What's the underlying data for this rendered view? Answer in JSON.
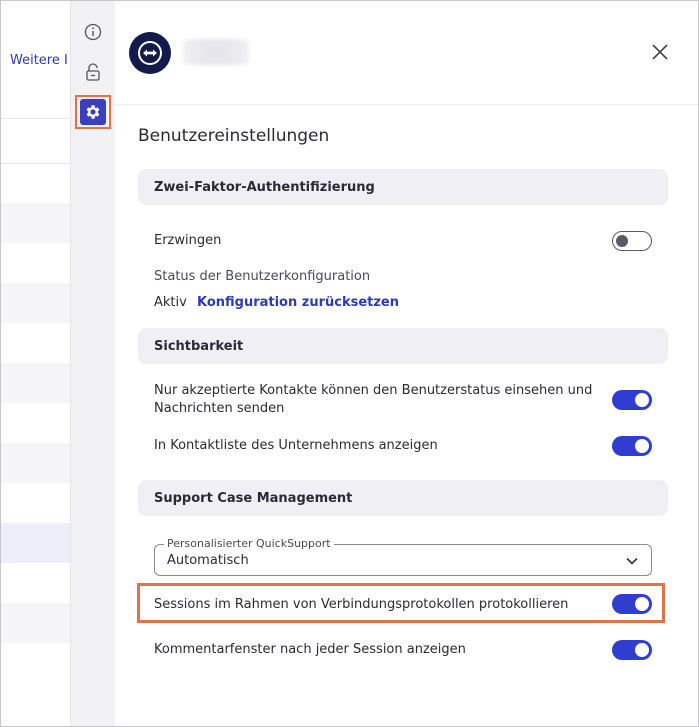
{
  "background": {
    "link_text": "Weitere I"
  },
  "rail": {
    "icons": [
      "info-icon",
      "lock-icon",
      "gear-icon"
    ]
  },
  "header": {
    "close_label": "×"
  },
  "page_title": "Benutzereinstellungen",
  "sections": {
    "two_factor": {
      "title": "Zwei-Faktor-Authentifizierung",
      "enforce_label": "Erzwingen",
      "enforce_on": false,
      "status_label": "Status der Benutzerkonfiguration",
      "status_value": "Aktiv",
      "reset_link": "Konfiguration zurücksetzen"
    },
    "visibility": {
      "title": "Sichtbarkeit",
      "accepted_contacts_line1": "Nur akzeptierte Kontakte können den Benutzerstatus einsehen und",
      "accepted_contacts_line2": "Nachrichten senden",
      "accepted_contacts_on": true,
      "company_list_label": "In Kontaktliste des Unternehmens anzeigen",
      "company_list_on": true
    },
    "support": {
      "title": "Support Case Management",
      "quicksupport_label": "Personalisierter QuickSupport",
      "quicksupport_value": "Automatisch",
      "log_sessions_label": "Sessions im Rahmen von Verbindungsprotokollen protokollieren",
      "log_sessions_on": true,
      "comment_window_label": "Kommentarfenster nach jeder Session anzeigen",
      "comment_window_on": true
    }
  },
  "colors": {
    "accent": "#2f3ed0",
    "highlight": "#e07449",
    "link": "#2d3ab8"
  }
}
